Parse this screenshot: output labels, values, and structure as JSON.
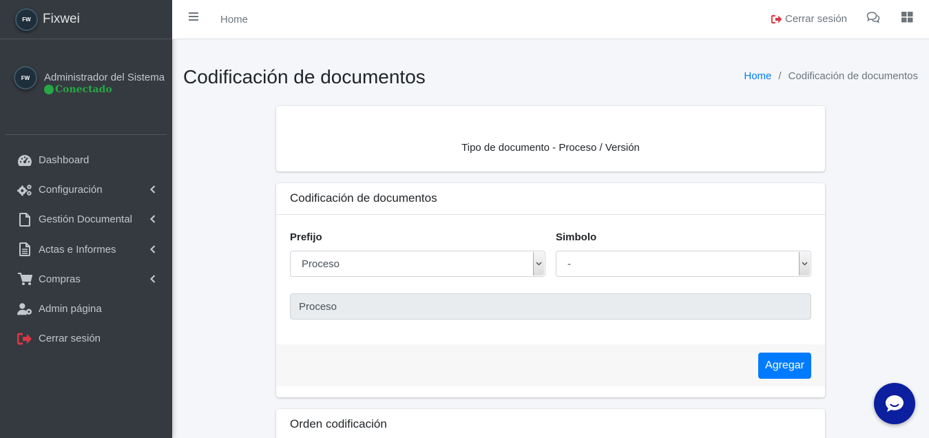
{
  "brand": {
    "logo_text": "FW",
    "name": "Fixwei"
  },
  "user": {
    "logo_text": "FW",
    "name": "Administrador del Sistema",
    "status": "Conectado"
  },
  "sidebar": {
    "items": [
      {
        "label": "Dashboard",
        "icon": "dashboard-icon",
        "has_submenu": false
      },
      {
        "label": "Configuración",
        "icon": "gears-icon",
        "has_submenu": true
      },
      {
        "label": "Gestión Documental",
        "icon": "file-icon",
        "has_submenu": true
      },
      {
        "label": "Actas e Informes",
        "icon": "file-text-icon",
        "has_submenu": true
      },
      {
        "label": "Compras",
        "icon": "cart-icon",
        "has_submenu": true
      },
      {
        "label": "Admin página",
        "icon": "user-cog-icon",
        "has_submenu": false
      },
      {
        "label": "Cerrar sesión",
        "icon": "sign-out-icon",
        "has_submenu": false
      }
    ]
  },
  "topbar": {
    "home_label": "Home",
    "logout_label": "Cerrar sesión"
  },
  "page": {
    "title": "Codificación de documentos",
    "breadcrumb": {
      "home": "Home",
      "current": "Codificación de documentos"
    }
  },
  "info_card": {
    "text": "Tipo de documento - Proceso / Versión"
  },
  "form_card": {
    "title": "Codificación de documentos",
    "prefix_label": "Prefijo",
    "prefix_value": "Proceso",
    "symbol_label": "Simbolo",
    "symbol_value": "-",
    "preview_value": "Proceso",
    "add_button": "Agregar"
  },
  "order_card": {
    "title": "Orden codificación"
  },
  "colors": {
    "sidebar": "#343a40",
    "accent": "#007bff",
    "status": "#28a745",
    "logout_icon": "#dc3545",
    "chat_bubble": "#0b1f9f"
  }
}
